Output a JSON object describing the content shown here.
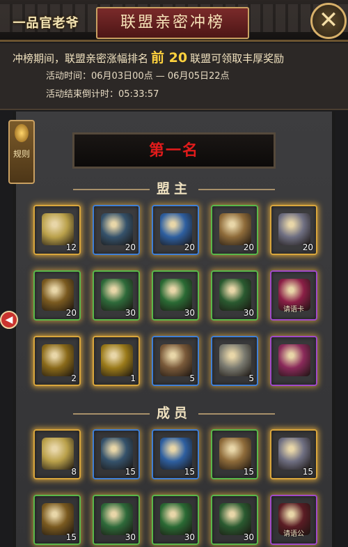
{
  "header": {
    "logo_text": "一品官老爷",
    "title": "联盟亲密冲榜",
    "close_label": "✕"
  },
  "info": {
    "line1_pre": "冲榜期间，联盟亲密涨幅排名",
    "line1_mid": "前 20",
    "line1_post": "联盟可领取丰厚奖励",
    "time_label": "活动时间：",
    "time_value": "06月03日00点 — 06月05日22点",
    "countdown_label": "活动结束倒计时：",
    "countdown_value": "05:33:57"
  },
  "rules_label": "规则",
  "left_arrow": "◀",
  "rank_title": "第一名",
  "sections": {
    "leader": "盟主",
    "member": "成员"
  },
  "leader_items": [
    {
      "icon": "gold-silver-ingots-icon",
      "count": "12",
      "quality": "q-gold",
      "color": "#b9a04a"
    },
    {
      "icon": "book-pouch-icon",
      "count": "20",
      "quality": "q-blue",
      "color": "#35526b"
    },
    {
      "icon": "blue-book-icon",
      "count": "20",
      "quality": "q-blue",
      "color": "#2e5fa0"
    },
    {
      "icon": "peach-bowl-icon",
      "count": "20",
      "quality": "q-green",
      "color": "#8e6b3a"
    },
    {
      "icon": "rainbow-gem-icon",
      "count": "20",
      "quality": "q-gold",
      "color": "#6f6f82"
    },
    {
      "icon": "golden-ornament-icon",
      "count": "20",
      "quality": "q-green",
      "color": "#7a5a20"
    },
    {
      "icon": "green-robe-icon",
      "count": "30",
      "quality": "q-green",
      "color": "#2e6a3a"
    },
    {
      "icon": "green-hat-icon",
      "count": "30",
      "quality": "q-green",
      "color": "#2a6a34"
    },
    {
      "icon": "green-boot-icon",
      "count": "30",
      "quality": "q-green",
      "color": "#2a5a30"
    },
    {
      "icon": "pink-token-icon",
      "count": "",
      "label": "请语卡",
      "quality": "q-purple",
      "color": "#8a1f46"
    },
    {
      "icon": "golden-robe-icon",
      "count": "2",
      "quality": "q-gold",
      "color": "#8a6a1a"
    },
    {
      "icon": "golden-tablet-icon",
      "count": "1",
      "quality": "q-gold",
      "color": "#9a7a1a"
    },
    {
      "icon": "pig-figure-icon",
      "count": "5",
      "quality": "q-blue",
      "color": "#7a5a3a"
    },
    {
      "icon": "silver-urn-icon",
      "count": "5",
      "quality": "q-blue",
      "color": "#7a7a70"
    },
    {
      "icon": "pink-gem-icon",
      "count": "",
      "quality": "q-purple",
      "color": "#8a2a5a"
    }
  ],
  "member_items": [
    {
      "icon": "gold-silver-ingots-icon",
      "count": "8",
      "quality": "q-gold",
      "color": "#b9a04a"
    },
    {
      "icon": "book-pouch-icon",
      "count": "15",
      "quality": "q-blue",
      "color": "#35526b"
    },
    {
      "icon": "blue-book-icon",
      "count": "15",
      "quality": "q-blue",
      "color": "#2e5fa0"
    },
    {
      "icon": "peach-bowl-icon",
      "count": "15",
      "quality": "q-green",
      "color": "#8e6b3a"
    },
    {
      "icon": "rainbow-gem-icon",
      "count": "15",
      "quality": "q-gold",
      "color": "#6f6f82"
    },
    {
      "icon": "golden-ornament-icon",
      "count": "15",
      "quality": "q-green",
      "color": "#7a5a20"
    },
    {
      "icon": "green-robe-icon",
      "count": "30",
      "quality": "q-green",
      "color": "#2e6a3a"
    },
    {
      "icon": "green-hat-icon",
      "count": "30",
      "quality": "q-green",
      "color": "#2a6a34"
    },
    {
      "icon": "green-boot-icon",
      "count": "30",
      "quality": "q-green",
      "color": "#2a5a30"
    },
    {
      "icon": "red-gift-icon",
      "count": "",
      "label": "请语公",
      "quality": "q-purple",
      "color": "#5a1c24"
    }
  ]
}
